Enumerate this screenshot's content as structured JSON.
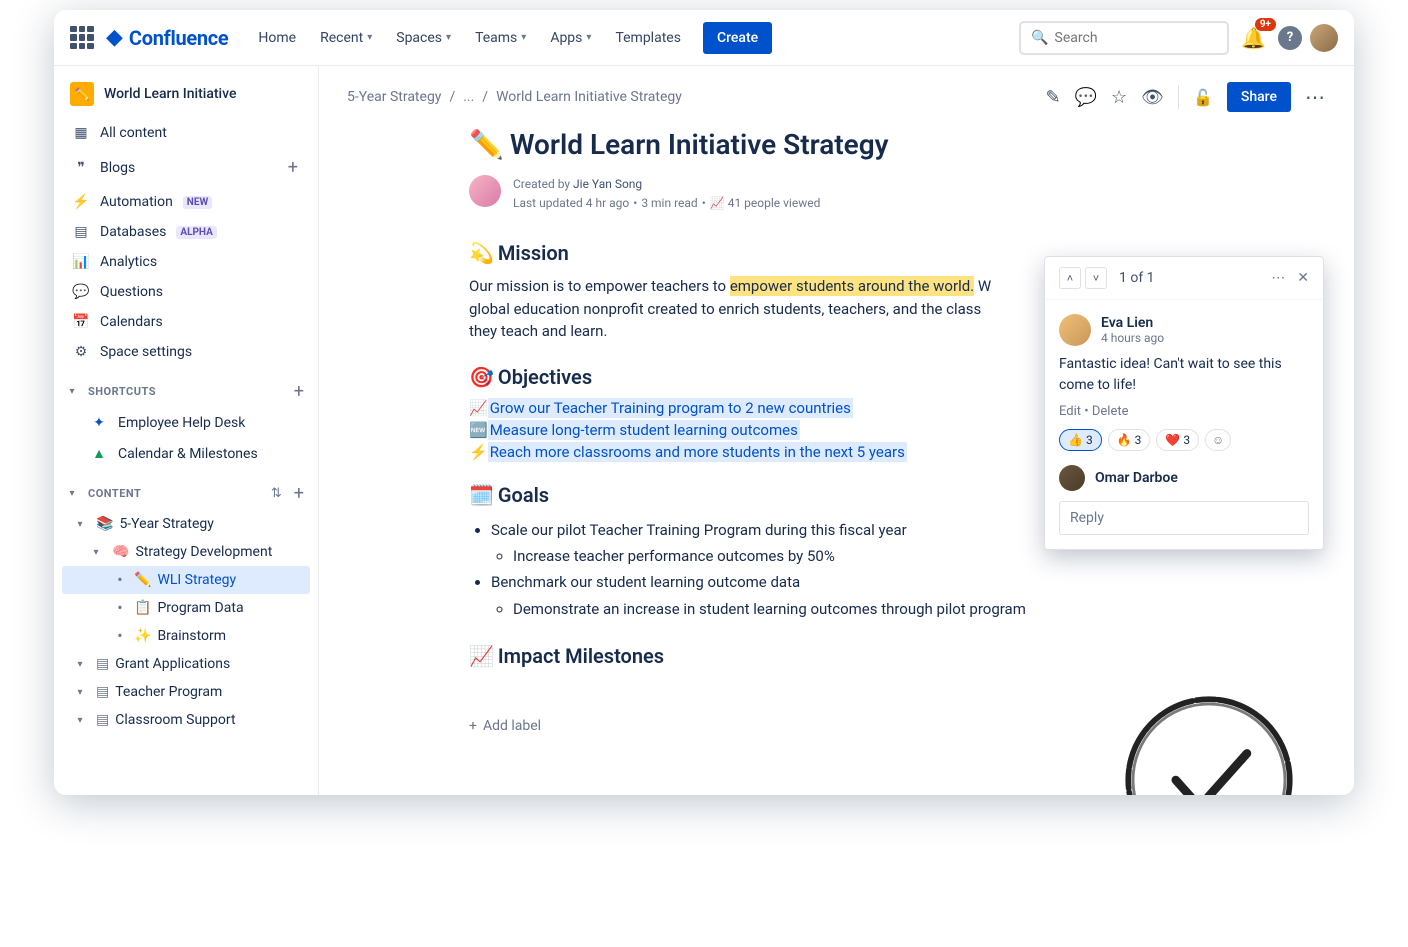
{
  "brand": "Confluence",
  "nav": {
    "home": "Home",
    "recent": "Recent",
    "spaces": "Spaces",
    "teams": "Teams",
    "apps": "Apps",
    "templates": "Templates",
    "create": "Create"
  },
  "search": {
    "placeholder": "Search"
  },
  "notifications_badge": "9+",
  "space": {
    "name": "World Learn Initiative"
  },
  "sidebar": {
    "all_content": "All content",
    "blogs": "Blogs",
    "automation": "Automation",
    "automation_badge": "NEW",
    "databases": "Databases",
    "databases_badge": "ALPHA",
    "analytics": "Analytics",
    "questions": "Questions",
    "calendars": "Calendars",
    "space_settings": "Space settings",
    "shortcuts_label": "SHORTCUTS",
    "shortcuts": [
      "Employee Help Desk",
      "Calendar & Milestones"
    ],
    "content_label": "CONTENT",
    "tree": {
      "five_year": "5-Year Strategy",
      "strategy_dev": "Strategy Development",
      "wli_strategy": "WLI Strategy",
      "program_data": "Program Data",
      "brainstorm": "Brainstorm",
      "grant_apps": "Grant Applications",
      "teacher_program": "Teacher Program",
      "classroom_support": "Classroom Support"
    }
  },
  "breadcrumb": {
    "a": "5-Year Strategy",
    "b": "...",
    "c": "World Learn Initiative Strategy"
  },
  "page_actions": {
    "share": "Share"
  },
  "page": {
    "title_emoji": "✏️",
    "title": "World Learn Initiative Strategy",
    "created_by_label": "Created by",
    "author": "Jie Yan Song",
    "last_updated": "Last updated 4 hr ago",
    "read_time": "3 min read",
    "views": "41 people viewed"
  },
  "sections": {
    "mission": {
      "emoji": "💫",
      "title": "Mission",
      "text_a": "Our mission is to empower teachers to ",
      "highlight": "empower students around the world.",
      "text_b": " W",
      "text_c": "global education nonprofit created to enrich students, teachers, and the class",
      "text_d": "they teach and learn."
    },
    "objectives": {
      "emoji": "🎯",
      "title": "Objectives",
      "items": [
        {
          "emoji": "📈",
          "text": "Grow our Teacher Training program to 2 new countries"
        },
        {
          "emoji": "🆕",
          "text": "Measure long-term student learning outcomes"
        },
        {
          "emoji": "⚡",
          "text": "Reach more classrooms and more students in the next 5 years"
        }
      ]
    },
    "goals": {
      "emoji": "🗓️",
      "title": "Goals",
      "g1": "Scale our pilot Teacher Training Program during this fiscal year",
      "g1a": "Increase teacher performance outcomes by 50%",
      "g2": "Benchmark our student learning outcome data",
      "g2a": "Demonstrate an increase in student learning outcomes through pilot program"
    },
    "impact": {
      "emoji": "📈",
      "title": "Impact Milestones"
    }
  },
  "add_label": "Add label",
  "comment": {
    "count": "1 of 1",
    "author": "Eva Lien",
    "time": "4 hours ago",
    "text": "Fantastic idea! Can't wait to see this come to life!",
    "edit": "Edit",
    "delete": "Delete",
    "reactions": [
      {
        "emoji": "👍",
        "count": "3",
        "active": true
      },
      {
        "emoji": "🔥",
        "count": "3",
        "active": false
      },
      {
        "emoji": "❤️",
        "count": "3",
        "active": false
      }
    ],
    "reply_user": "Omar Darboe",
    "reply_placeholder": "Reply"
  }
}
